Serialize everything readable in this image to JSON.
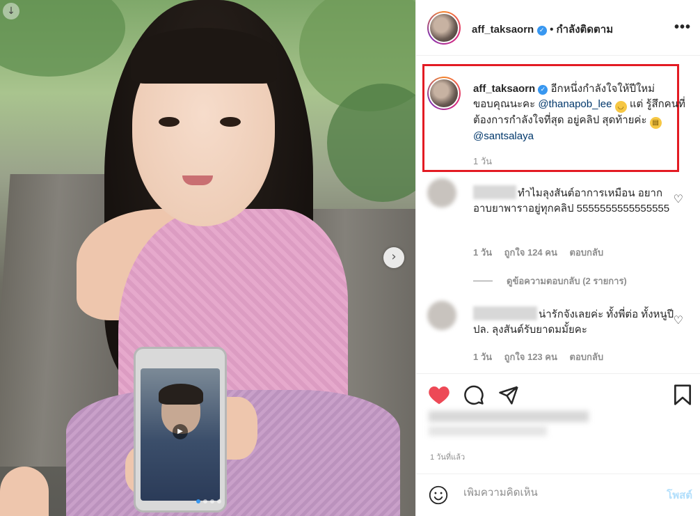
{
  "post": {
    "username": "aff_taksaorn",
    "follow_status": "• กำลังติดตาม",
    "more_icon": "more-horizontal-icon",
    "accent": "#3897f0",
    "like_color": "#ed4956",
    "highlight_color": "#e31b23",
    "carousel": {
      "slides": 4,
      "active": 1
    }
  },
  "caption": {
    "username": "aff_taksaorn",
    "text_1": "อีกหนึ่งกำลังใจให้ปีใหม่ ขอบคุณนะคะ",
    "mention_1": "@thanapob_lee",
    "text_2": "แต่ รู้สึกคนที่ต้องการกำลังใจที่สุด อยู่คลิป สุดท้ายค่ะ",
    "mention_2": "@santsalaya",
    "time": "1 วัน"
  },
  "comments": [
    {
      "text": "ทำไมลุงสันต์อาการเหมือน อยากอาบยาพาราอยู่ทุกคลิป 5555555555555555",
      "time": "1 วัน",
      "likes": "ถูกใจ 124 คน",
      "reply": "ตอบกลับ"
    },
    {
      "text": "น่ารักจังเลยค่ะ ทั้งพี่ต่อ ทั้งหนูปี ปล. ลุงสันต์รับยาดมมั้ยคะ",
      "time": "1 วัน",
      "likes": "ถูกใจ 123 คน",
      "reply": "ตอบกลับ"
    }
  ],
  "view_replies": "ดูข้อความตอบกลับ (2 รายการ)",
  "timestamp": "1 วันที่แล้ว",
  "comment_box": {
    "placeholder": "เพิ่มความคิดเห็น",
    "post_label": "โพสต์"
  }
}
